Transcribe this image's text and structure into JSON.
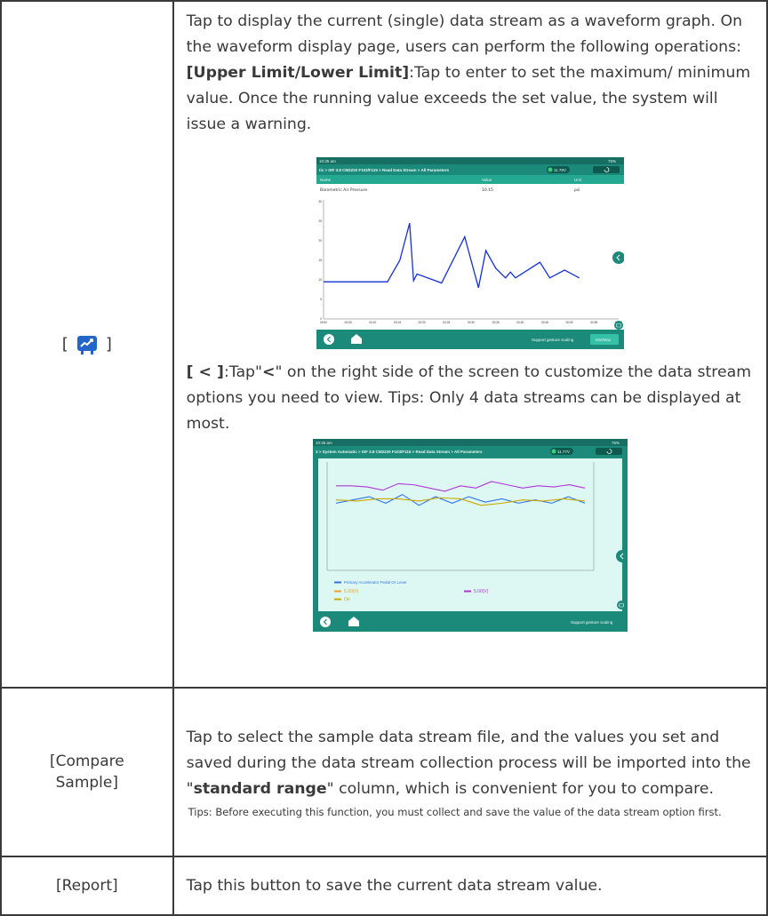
{
  "row1": {
    "left_open": "[",
    "left_close": "]",
    "icon": "waveform-chart-icon",
    "intro": "Tap to display the current (single) data stream as a waveform graph. On the waveform display page, users can perform the following operations:",
    "upper_label": "[Upper Limit/Lower Limit]",
    "upper_text": ":Tap to enter to set the maximum/ minimum value. Once the running value exceeds the set value, the system will issue a warning.",
    "less_label": "[ < ]",
    "less_text_a": ":Tap\"",
    "less_symbol": "<",
    "less_text_b": "\" on the right side of the screen to customize the data stream options you need to view. Tips: Only 4 data streams can be displayed at most."
  },
  "screen1": {
    "status_time": "10:35 am",
    "status_battery": "75%",
    "breadcrumb": "tic > ISF 3.8 CM2220 F103/F115 > Read Data Stream > All Parameters",
    "voltage": "11.78V",
    "col_name": "Name",
    "col_value": "Value",
    "col_unit": "Unit",
    "row_name": "Barometric Air Pressure",
    "row_value": "10.15",
    "row_unit": "psi",
    "footer_hint": "Support gesture scaling",
    "footer_button": "Min/Max",
    "accent": "#1a9a86",
    "line_color": "#1530d6"
  },
  "chart_data": [
    {
      "type": "line",
      "y_ticks": [
        "0",
        "5",
        "10",
        "15",
        "20",
        "25",
        "30"
      ],
      "x_ticks": [
        "00:00",
        "00:05",
        "00:10",
        "00:15",
        "00:20",
        "00:25",
        "00:30",
        "00:35",
        "00:40",
        "00:45",
        "00:50",
        "00:55",
        "01:00"
      ],
      "ylim": [
        0,
        30
      ],
      "series": [
        {
          "x": [
            0,
            13,
            15.5,
            17.5,
            18.3,
            19,
            24,
            28.7,
            31.5,
            33,
            35,
            37,
            38,
            39,
            44,
            46,
            49,
            52
          ],
          "values": [
            9.5,
            9.5,
            15,
            24.5,
            9.8,
            11.5,
            9.2,
            21,
            8,
            17.5,
            13,
            10.5,
            12,
            10.5,
            14.5,
            10.5,
            12.5,
            10.5
          ]
        }
      ]
    },
    {
      "type": "line",
      "legend": [
        {
          "label": "Primary Accelerator Pedal Or Lever",
          "color": "#2e74e8"
        },
        {
          "label": "5.00(V)",
          "color": "#f0a030"
        },
        {
          "label": "5.00(V)",
          "color": "#b036d8"
        },
        {
          "label": "On",
          "color": "#c9a800"
        }
      ],
      "series": [
        {
          "color": "#b036d8",
          "values": [
            78,
            78,
            77,
            74,
            80,
            79,
            76,
            73,
            78,
            76,
            82,
            79,
            76,
            78,
            77,
            79,
            76
          ]
        },
        {
          "color": "#2e74e8",
          "values": [
            62,
            65,
            68,
            62,
            70,
            60,
            68,
            62,
            68,
            63,
            66,
            62,
            65,
            62,
            68,
            62
          ]
        },
        {
          "color": "#c9a800",
          "values": [
            65,
            64,
            66,
            66,
            64,
            67,
            66,
            60,
            62,
            65,
            64,
            66,
            64
          ]
        }
      ]
    }
  ],
  "screen2": {
    "breadcrumb": "3 > System Automatic > ISF 3.8 CM2220 F103/F115 > Read Data Stream > All Parameters",
    "voltage": "11.77V",
    "footer_hint": "Support gesture scaling"
  },
  "row2": {
    "left": "[Compare Sample]",
    "text_a": "Tap to select the sample data stream file, and the values you set and saved during the data stream collection process will be imported into the \"",
    "text_bold": "standard range",
    "text_b": "\" column, which is convenient for you to compare.",
    "tips": "Tips: Before executing this function, you must collect and save the value of the data stream option first."
  },
  "row3": {
    "left": "[Report]",
    "text": "Tap this button to save the current data stream value."
  }
}
